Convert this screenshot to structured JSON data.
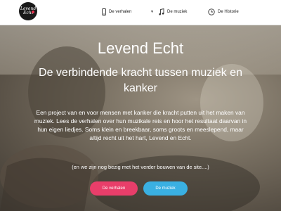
{
  "logo": {
    "text": "Levend\nEcht"
  },
  "nav": {
    "items": [
      {
        "label": "De verhalen",
        "icon": "phone-icon"
      },
      {
        "label": "De muziek",
        "icon": "music-note-icon"
      },
      {
        "label": "De Historie",
        "icon": "clock-icon"
      }
    ]
  },
  "hero": {
    "title": "Levend Echt",
    "subtitle": "De verbindende kracht tussen muziek en kanker",
    "lead": "Een project van en voor mensen met kanker die kracht putten uit het maken van muziek. Lees de verhalen over hun muzikale reis en hoor het resultaat daarvan in hun eigen liedjes. Soms klein en breekbaar, soms groots en meeslepend, maar altijd recht uit het hart, Levend en Echt.",
    "note": "(en we zijn nog bezig met het verder bouwen van de site....)",
    "buttons": {
      "stories": "De verhalen",
      "music": "De muziek"
    }
  },
  "colors": {
    "button_stories": "#e83e6a",
    "button_music": "#3ab0e2"
  }
}
